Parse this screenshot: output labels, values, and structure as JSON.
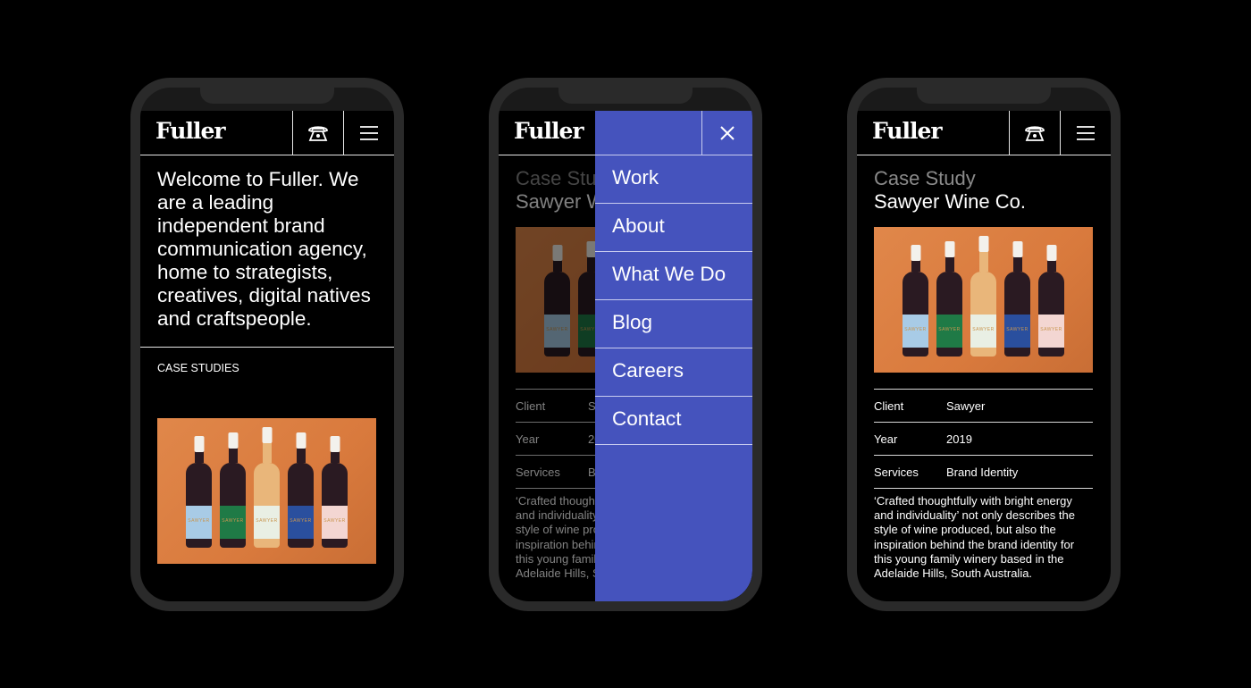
{
  "brand": {
    "logo": "Fuller",
    "menu_color": "#4553bd",
    "photo_color": "#dc7f42"
  },
  "icons": {
    "phone": "telephone-icon",
    "menu": "hamburger-menu-icon",
    "close": "close-icon"
  },
  "screen_home": {
    "intro": "Welcome to Fuller. We are a leading independent brand communication agency, home to strategists, creatives, digital natives and craftspeople.",
    "section_label": "CASE STUDIES"
  },
  "case_study": {
    "kicker": "Case Study",
    "title": "Sawyer Wine Co.",
    "bottle_brand": "SAWYER",
    "details": [
      {
        "key": "Client",
        "value": "Sawyer"
      },
      {
        "key": "Year",
        "value": "2019"
      },
      {
        "key": "Services",
        "value": "Brand Identity"
      }
    ],
    "description": "‘Crafted thoughtfully with bright energy and individuality’ not only describes the style of wine produced, but also the inspiration behind the brand identity for this young family winery based in the Adelaide Hills, South Australia."
  },
  "menu": {
    "items": [
      "Work",
      "About",
      "What We Do",
      "Blog",
      "Careers",
      "Contact"
    ]
  }
}
